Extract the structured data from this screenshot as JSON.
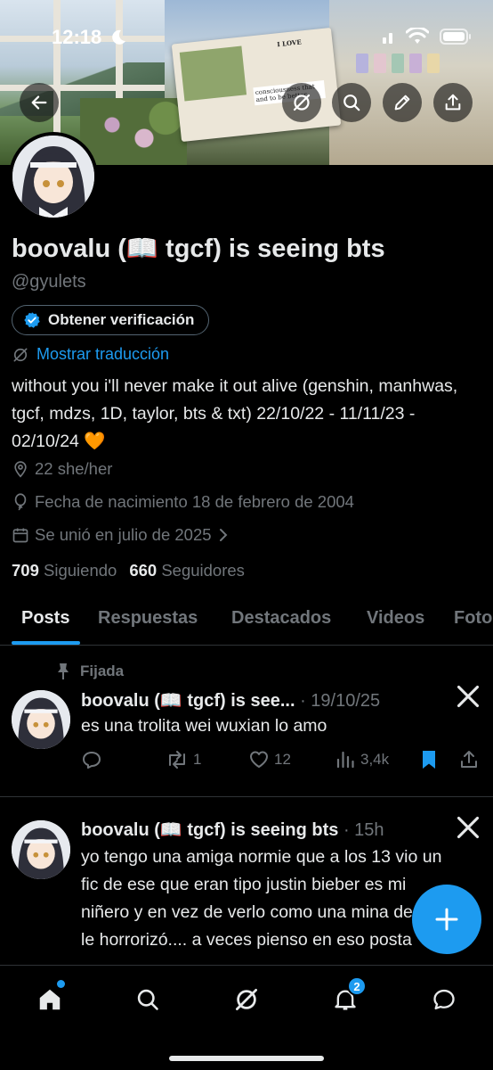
{
  "status_bar": {
    "time": "12:18"
  },
  "banner": {
    "book_text_1": "I LOVE",
    "book_text_2": "consciousness that and to be better"
  },
  "profile": {
    "display_name": "boovalu (📖 tgcf) is seeing bts",
    "handle": "@gyulets",
    "verify_button": "Obtener verificación",
    "translate_link": "Mostrar traducción",
    "bio": "without you i'll never make it out alive (genshin, manhwas, tgcf, mdzs, 1D, taylor, bts & txt) 22/10/22 - 11/11/23 - 02/10/24 🧡",
    "location": "22 she/her",
    "birthday": "Fecha de nacimiento 18 de febrero de 2004",
    "joined": "Se unió en julio de 2025",
    "following_count": "709",
    "following_label": "Siguiendo",
    "followers_count": "660",
    "followers_label": "Seguidores"
  },
  "tabs": [
    {
      "label": "Posts",
      "active": true
    },
    {
      "label": "Respuestas",
      "active": false
    },
    {
      "label": "Destacados",
      "active": false
    },
    {
      "label": "Videos",
      "active": false
    },
    {
      "label": "Fotos",
      "active": false
    }
  ],
  "posts": [
    {
      "pinned_label": "Fijada",
      "author": "boovalu (📖 tgcf) is see...",
      "time": "· 19/10/25",
      "text": "es una trolita wei wuxian lo amo",
      "replies": "",
      "reposts": "1",
      "likes": "12",
      "views": "3,4k",
      "bookmarked": true
    },
    {
      "author": "boovalu (📖 tgcf) is seeing bts",
      "time": "· 15h",
      "text": "yo tengo una amiga normie que a los 13 vio un fic de ese que eran tipo justin bieber es mi niñero y en vez de verlo como una mina de oro, le horrorizó.... a veces pienso en eso posta"
    }
  ],
  "bottom_nav": {
    "notifications_badge": "2"
  },
  "colors": {
    "accent": "#1d9bf0",
    "background": "#000000",
    "text_primary": "#e7e9ea",
    "text_secondary": "#71767b",
    "border": "#2f3336"
  }
}
